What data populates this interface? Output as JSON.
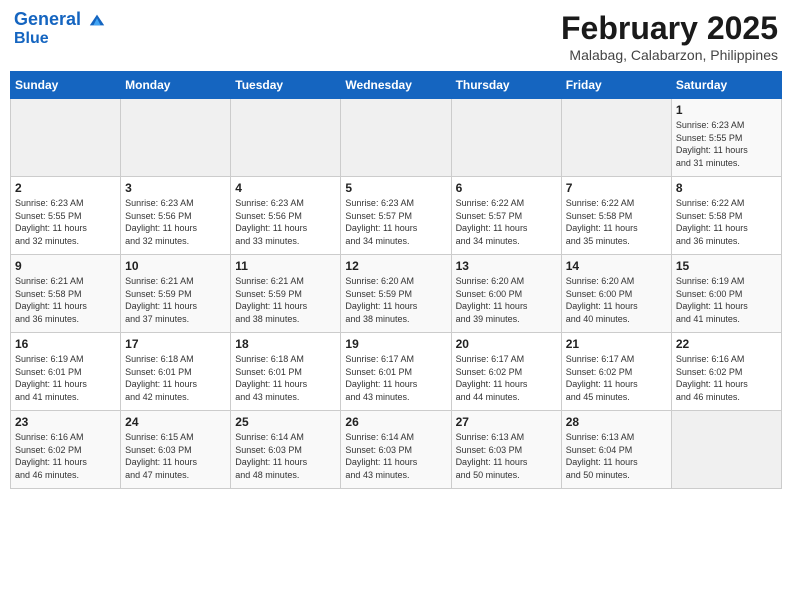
{
  "header": {
    "logo_line1": "General",
    "logo_line2": "Blue",
    "month_title": "February 2025",
    "location": "Malabag, Calabarzon, Philippines"
  },
  "weekdays": [
    "Sunday",
    "Monday",
    "Tuesday",
    "Wednesday",
    "Thursday",
    "Friday",
    "Saturday"
  ],
  "weeks": [
    [
      {
        "day": "",
        "info": ""
      },
      {
        "day": "",
        "info": ""
      },
      {
        "day": "",
        "info": ""
      },
      {
        "day": "",
        "info": ""
      },
      {
        "day": "",
        "info": ""
      },
      {
        "day": "",
        "info": ""
      },
      {
        "day": "1",
        "info": "Sunrise: 6:23 AM\nSunset: 5:55 PM\nDaylight: 11 hours\nand 31 minutes."
      }
    ],
    [
      {
        "day": "2",
        "info": "Sunrise: 6:23 AM\nSunset: 5:55 PM\nDaylight: 11 hours\nand 32 minutes."
      },
      {
        "day": "3",
        "info": "Sunrise: 6:23 AM\nSunset: 5:56 PM\nDaylight: 11 hours\nand 32 minutes."
      },
      {
        "day": "4",
        "info": "Sunrise: 6:23 AM\nSunset: 5:56 PM\nDaylight: 11 hours\nand 33 minutes."
      },
      {
        "day": "5",
        "info": "Sunrise: 6:23 AM\nSunset: 5:57 PM\nDaylight: 11 hours\nand 34 minutes."
      },
      {
        "day": "6",
        "info": "Sunrise: 6:22 AM\nSunset: 5:57 PM\nDaylight: 11 hours\nand 34 minutes."
      },
      {
        "day": "7",
        "info": "Sunrise: 6:22 AM\nSunset: 5:58 PM\nDaylight: 11 hours\nand 35 minutes."
      },
      {
        "day": "8",
        "info": "Sunrise: 6:22 AM\nSunset: 5:58 PM\nDaylight: 11 hours\nand 36 minutes."
      }
    ],
    [
      {
        "day": "9",
        "info": "Sunrise: 6:21 AM\nSunset: 5:58 PM\nDaylight: 11 hours\nand 36 minutes."
      },
      {
        "day": "10",
        "info": "Sunrise: 6:21 AM\nSunset: 5:59 PM\nDaylight: 11 hours\nand 37 minutes."
      },
      {
        "day": "11",
        "info": "Sunrise: 6:21 AM\nSunset: 5:59 PM\nDaylight: 11 hours\nand 38 minutes."
      },
      {
        "day": "12",
        "info": "Sunrise: 6:20 AM\nSunset: 5:59 PM\nDaylight: 11 hours\nand 38 minutes."
      },
      {
        "day": "13",
        "info": "Sunrise: 6:20 AM\nSunset: 6:00 PM\nDaylight: 11 hours\nand 39 minutes."
      },
      {
        "day": "14",
        "info": "Sunrise: 6:20 AM\nSunset: 6:00 PM\nDaylight: 11 hours\nand 40 minutes."
      },
      {
        "day": "15",
        "info": "Sunrise: 6:19 AM\nSunset: 6:00 PM\nDaylight: 11 hours\nand 41 minutes."
      }
    ],
    [
      {
        "day": "16",
        "info": "Sunrise: 6:19 AM\nSunset: 6:01 PM\nDaylight: 11 hours\nand 41 minutes."
      },
      {
        "day": "17",
        "info": "Sunrise: 6:18 AM\nSunset: 6:01 PM\nDaylight: 11 hours\nand 42 minutes."
      },
      {
        "day": "18",
        "info": "Sunrise: 6:18 AM\nSunset: 6:01 PM\nDaylight: 11 hours\nand 43 minutes."
      },
      {
        "day": "19",
        "info": "Sunrise: 6:17 AM\nSunset: 6:01 PM\nDaylight: 11 hours\nand 43 minutes."
      },
      {
        "day": "20",
        "info": "Sunrise: 6:17 AM\nSunset: 6:02 PM\nDaylight: 11 hours\nand 44 minutes."
      },
      {
        "day": "21",
        "info": "Sunrise: 6:17 AM\nSunset: 6:02 PM\nDaylight: 11 hours\nand 45 minutes."
      },
      {
        "day": "22",
        "info": "Sunrise: 6:16 AM\nSunset: 6:02 PM\nDaylight: 11 hours\nand 46 minutes."
      }
    ],
    [
      {
        "day": "23",
        "info": "Sunrise: 6:16 AM\nSunset: 6:02 PM\nDaylight: 11 hours\nand 46 minutes."
      },
      {
        "day": "24",
        "info": "Sunrise: 6:15 AM\nSunset: 6:03 PM\nDaylight: 11 hours\nand 47 minutes."
      },
      {
        "day": "25",
        "info": "Sunrise: 6:14 AM\nSunset: 6:03 PM\nDaylight: 11 hours\nand 48 minutes."
      },
      {
        "day": "26",
        "info": "Sunrise: 6:14 AM\nSunset: 6:03 PM\nDaylight: 11 hours\nand 43 minutes."
      },
      {
        "day": "27",
        "info": "Sunrise: 6:13 AM\nSunset: 6:03 PM\nDaylight: 11 hours\nand 50 minutes."
      },
      {
        "day": "28",
        "info": "Sunrise: 6:13 AM\nSunset: 6:04 PM\nDaylight: 11 hours\nand 50 minutes."
      },
      {
        "day": "",
        "info": ""
      }
    ]
  ]
}
